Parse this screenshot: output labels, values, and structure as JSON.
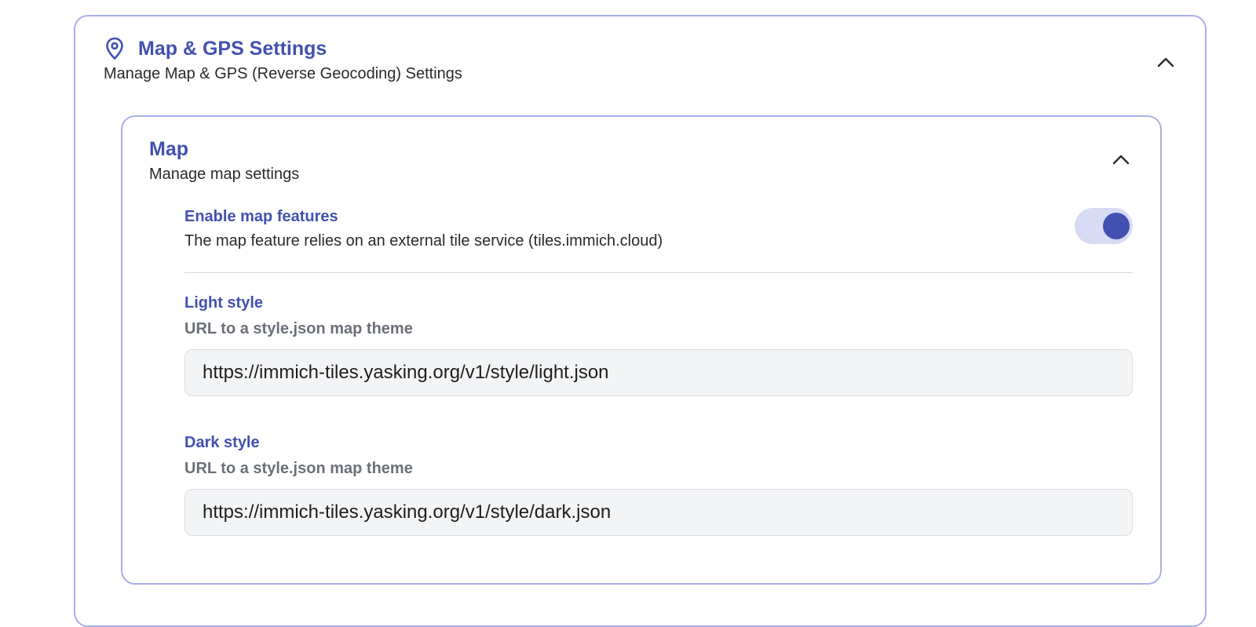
{
  "section": {
    "title": "Map & GPS Settings",
    "subtitle": "Manage Map & GPS (Reverse Geocoding) Settings",
    "icon": "map-pin-icon",
    "expanded": true
  },
  "map_card": {
    "title": "Map",
    "subtitle": "Manage map settings",
    "expanded": true,
    "enable_features": {
      "label": "Enable map features",
      "description": "The map feature relies on an external tile service (tiles.immich.cloud)",
      "enabled": true
    },
    "light_style": {
      "label": "Light style",
      "hint": "URL to a style.json map theme",
      "value": "https://immich-tiles.yasking.org/v1/style/light.json"
    },
    "dark_style": {
      "label": "Dark style",
      "hint": "URL to a style.json map theme",
      "value": "https://immich-tiles.yasking.org/v1/style/dark.json"
    }
  },
  "colors": {
    "accent": "#4250af",
    "border": "#a9aee6",
    "toggle_track": "#d7dbf4",
    "input_bg": "#f3f4f6"
  }
}
